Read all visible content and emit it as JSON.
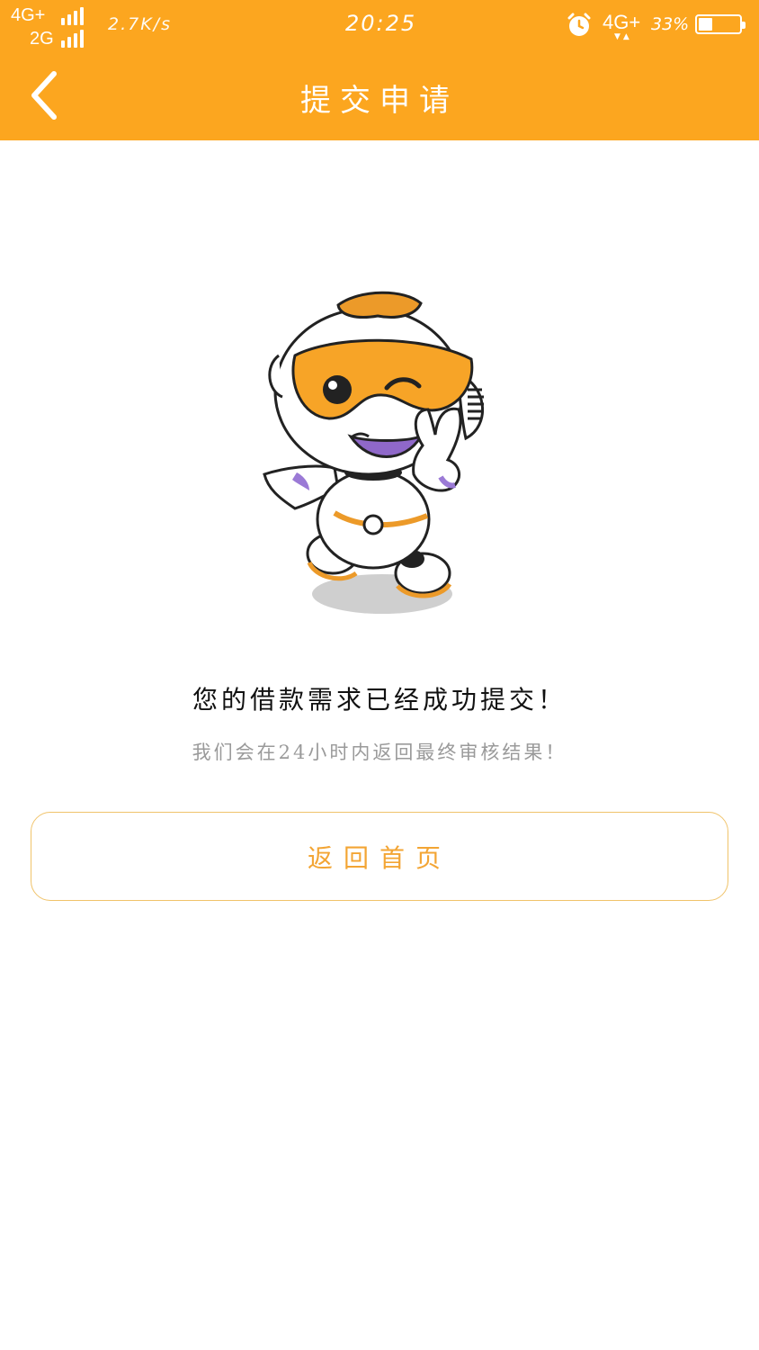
{
  "status_bar": {
    "network_1": "4G+",
    "network_2": "2G",
    "speed": "2.7K/s",
    "time": "20:25",
    "network_3": "4G+",
    "battery": "33%"
  },
  "nav": {
    "title": "提交申请",
    "back_icon": "chevron-left-icon"
  },
  "mascot": {
    "icon": "robot-mascot-icon"
  },
  "message": {
    "main": "您的借款需求已经成功提交！",
    "sub": "我们会在24小时内返回最终审核结果！"
  },
  "actions": {
    "home_button": "返回首页"
  },
  "colors": {
    "brand": "#fca61f",
    "button_text": "#f3a534",
    "button_border": "#f0c36a"
  }
}
